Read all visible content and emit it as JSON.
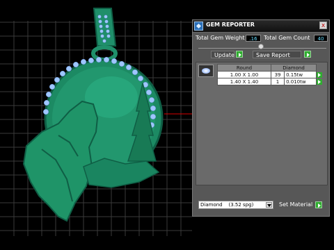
{
  "panel": {
    "title": "GEM REPORTER",
    "close_label": "x",
    "weight_label": "Total Gem Weight",
    "weight_value": ".16",
    "count_label": "Total Gem Count",
    "count_value": "40",
    "update_label": "Update",
    "save_label": "Save Report",
    "table": {
      "col1": "Round",
      "col2": "Diamond",
      "rows": [
        {
          "size": "1.00 X 1.00",
          "count": "39",
          "weight": "0.15tw"
        },
        {
          "size": "1.40 X 1.40",
          "count": "1",
          "weight": "0.010tw"
        }
      ]
    },
    "material_value": "Diamond    (3.52 spg)",
    "set_material_label": "Set Material"
  },
  "colors": {
    "pendant": "#1f8f6a",
    "gems": "#9fc6ff",
    "grid": "#3a3a3a"
  }
}
